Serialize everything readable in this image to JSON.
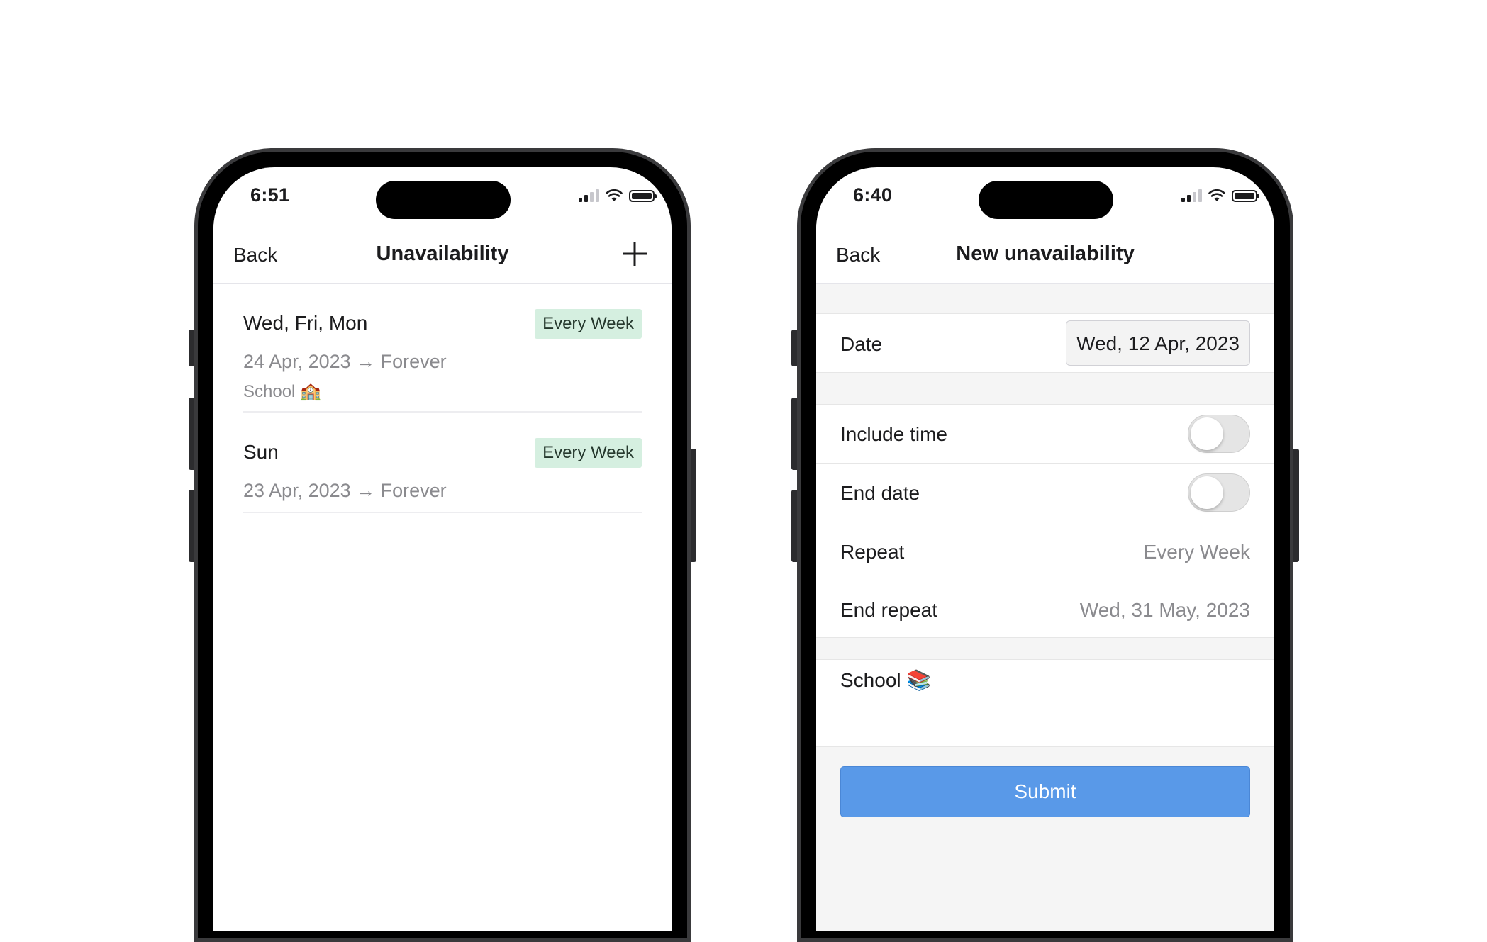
{
  "list_screen": {
    "status": {
      "time": "6:51"
    },
    "nav": {
      "back_label": "Back",
      "title": "Unavailability",
      "add_icon": "plus-icon"
    },
    "items": [
      {
        "days": "Wed, Fri, Mon",
        "repeat": "Every Week",
        "range": "24 Apr, 2023 → Forever",
        "note": "School 🏫"
      },
      {
        "days": "Sun",
        "repeat": "Every Week",
        "range": "23 Apr, 2023 → Forever"
      }
    ]
  },
  "form_screen": {
    "status": {
      "time": "6:40"
    },
    "nav": {
      "back_label": "Back",
      "title": "New unavailability"
    },
    "date": {
      "label": "Date",
      "value": "Wed, 12 Apr, 2023"
    },
    "include_time": {
      "label": "Include time",
      "on": false
    },
    "end_date": {
      "label": "End date",
      "on": false
    },
    "repeat": {
      "label": "Repeat",
      "value": "Every Week"
    },
    "end_repeat": {
      "label": "End repeat",
      "value": "Wed, 31 May, 2023"
    },
    "notes": {
      "value": "School 📚"
    },
    "submit_label": "Submit"
  },
  "colors": {
    "badge_bg": "#d5efe0",
    "submit_bg": "#5999e8",
    "secondary_text": "#8a8a8e"
  }
}
